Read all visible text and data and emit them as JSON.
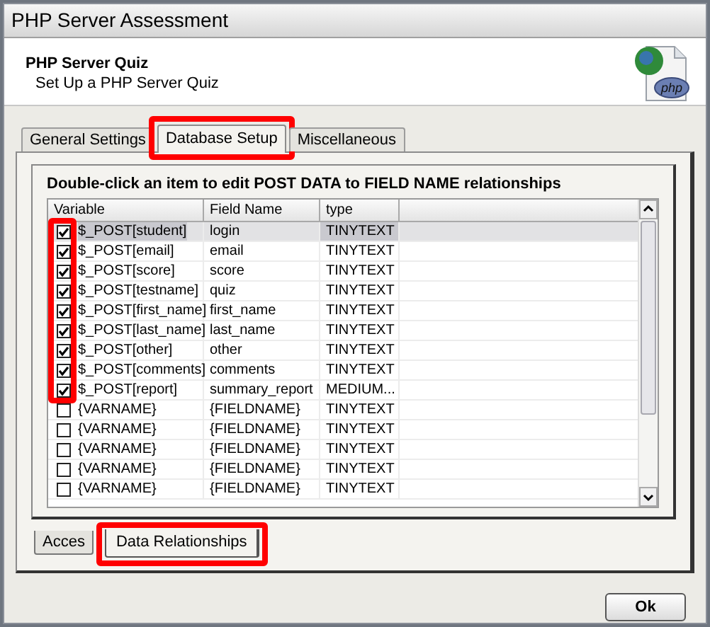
{
  "window": {
    "title": "PHP Server Assessment"
  },
  "header": {
    "title": "PHP Server Quiz",
    "subtitle": "Set Up a PHP Server Quiz",
    "icon_label": "php"
  },
  "tabs": [
    {
      "label": "General Settings",
      "selected": false,
      "highlighted": false
    },
    {
      "label": "Database Setup",
      "selected": true,
      "highlighted": true
    },
    {
      "label": "Miscellaneous",
      "selected": false,
      "highlighted": false
    }
  ],
  "panel": {
    "caption": "Double-click an item to edit POST DATA to FIELD NAME relationships"
  },
  "table": {
    "columns": [
      "Variable",
      "Field Name",
      "type"
    ],
    "checkbox_column_highlighted": true,
    "rows": [
      {
        "checked": true,
        "selected": true,
        "cells": [
          "$_POST[student]",
          "login",
          "TINYTEXT"
        ]
      },
      {
        "checked": true,
        "selected": false,
        "cells": [
          "$_POST[email]",
          "email",
          "TINYTEXT"
        ]
      },
      {
        "checked": true,
        "selected": false,
        "cells": [
          "$_POST[score]",
          "score",
          "TINYTEXT"
        ]
      },
      {
        "checked": true,
        "selected": false,
        "cells": [
          "$_POST[testname]",
          "quiz",
          "TINYTEXT"
        ]
      },
      {
        "checked": true,
        "selected": false,
        "cells": [
          "$_POST[first_name]",
          "first_name",
          "TINYTEXT"
        ]
      },
      {
        "checked": true,
        "selected": false,
        "cells": [
          "$_POST[last_name]",
          "last_name",
          "TINYTEXT"
        ]
      },
      {
        "checked": true,
        "selected": false,
        "cells": [
          "$_POST[other]",
          "other",
          "TINYTEXT"
        ]
      },
      {
        "checked": true,
        "selected": false,
        "cells": [
          "$_POST[comments]",
          "comments",
          "TINYTEXT"
        ]
      },
      {
        "checked": true,
        "selected": false,
        "cells": [
          "$_POST[report]",
          "summary_report",
          "MEDIUM..."
        ]
      },
      {
        "checked": false,
        "selected": false,
        "cells": [
          "{VARNAME}",
          "{FIELDNAME}",
          "TINYTEXT"
        ]
      },
      {
        "checked": false,
        "selected": false,
        "cells": [
          "{VARNAME}",
          "{FIELDNAME}",
          "TINYTEXT"
        ]
      },
      {
        "checked": false,
        "selected": false,
        "cells": [
          "{VARNAME}",
          "{FIELDNAME}",
          "TINYTEXT"
        ]
      },
      {
        "checked": false,
        "selected": false,
        "cells": [
          "{VARNAME}",
          "{FIELDNAME}",
          "TINYTEXT"
        ]
      },
      {
        "checked": false,
        "selected": false,
        "cells": [
          "{VARNAME}",
          "{FIELDNAME}",
          "TINYTEXT"
        ]
      }
    ]
  },
  "bottom_tabs": [
    {
      "label": "Acces",
      "selected": false,
      "highlighted": false
    },
    {
      "label": "Data Relationships",
      "selected": true,
      "highlighted": true
    }
  ],
  "buttons": [
    "Ok"
  ]
}
